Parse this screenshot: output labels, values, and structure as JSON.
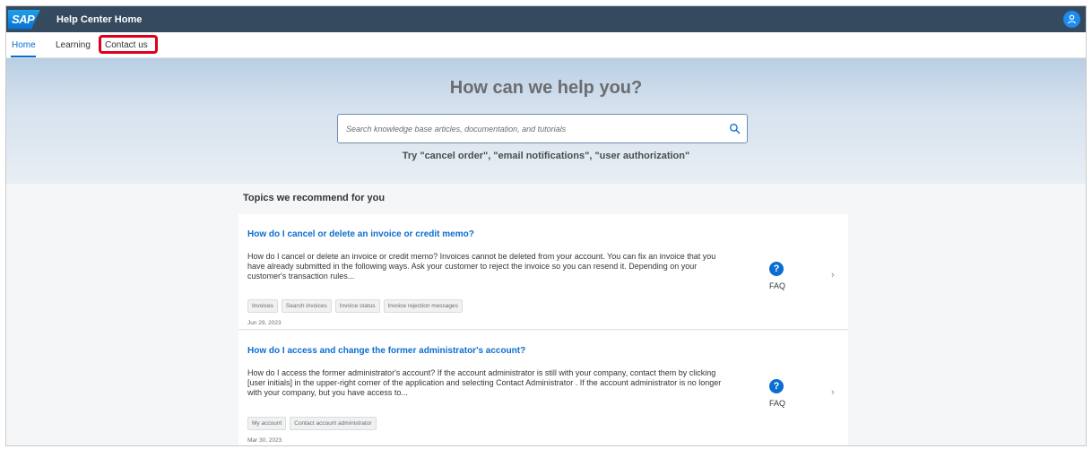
{
  "shell": {
    "logo_text": "SAP",
    "title": "Help Center Home",
    "avatar_icon": "person-icon"
  },
  "tabs": [
    {
      "label": "Home",
      "active": true
    },
    {
      "label": "Learning",
      "active": false
    },
    {
      "label": "Contact us",
      "active": false
    }
  ],
  "hero": {
    "title": "How can we help you?",
    "search_placeholder": "Search knowledge base articles, documentation, and tutorials",
    "search_icon": "search-icon",
    "try_text": "Try  \"cancel order\", \"email notifications\", \"user authorization\""
  },
  "recommend": {
    "section_title": "Topics we recommend for you",
    "cards": [
      {
        "title": "How do I cancel or delete an invoice or credit memo?",
        "body": "How do I cancel or delete an invoice or credit memo? Invoices cannot be deleted from your account. You can fix an invoice that you have already submitted in the following ways. Ask your customer to reject the invoice so you can resend it. Depending on your customer's transaction rules...",
        "tags": [
          "Invoices",
          "Search invoices",
          "Invoice status",
          "Invoice rejection messages"
        ],
        "date": "Jun 29, 2023",
        "type_label": "FAQ"
      },
      {
        "title": "How do I access and change the former administrator's account?",
        "body": "How do I access the former administrator's account? If the account administrator is still with your company, contact them by clicking [user initials] in the upper-right corner of the application and selecting Contact Administrator . If the account administrator is no longer with your company, but you have access to...",
        "tags": [
          "My account",
          "Contact account administrator"
        ],
        "date": "Mar 30, 2023",
        "type_label": "FAQ"
      }
    ]
  },
  "colors": {
    "shell_bg": "#354a5f",
    "accent": "#0a6ed1",
    "highlight": "#e0001a"
  }
}
